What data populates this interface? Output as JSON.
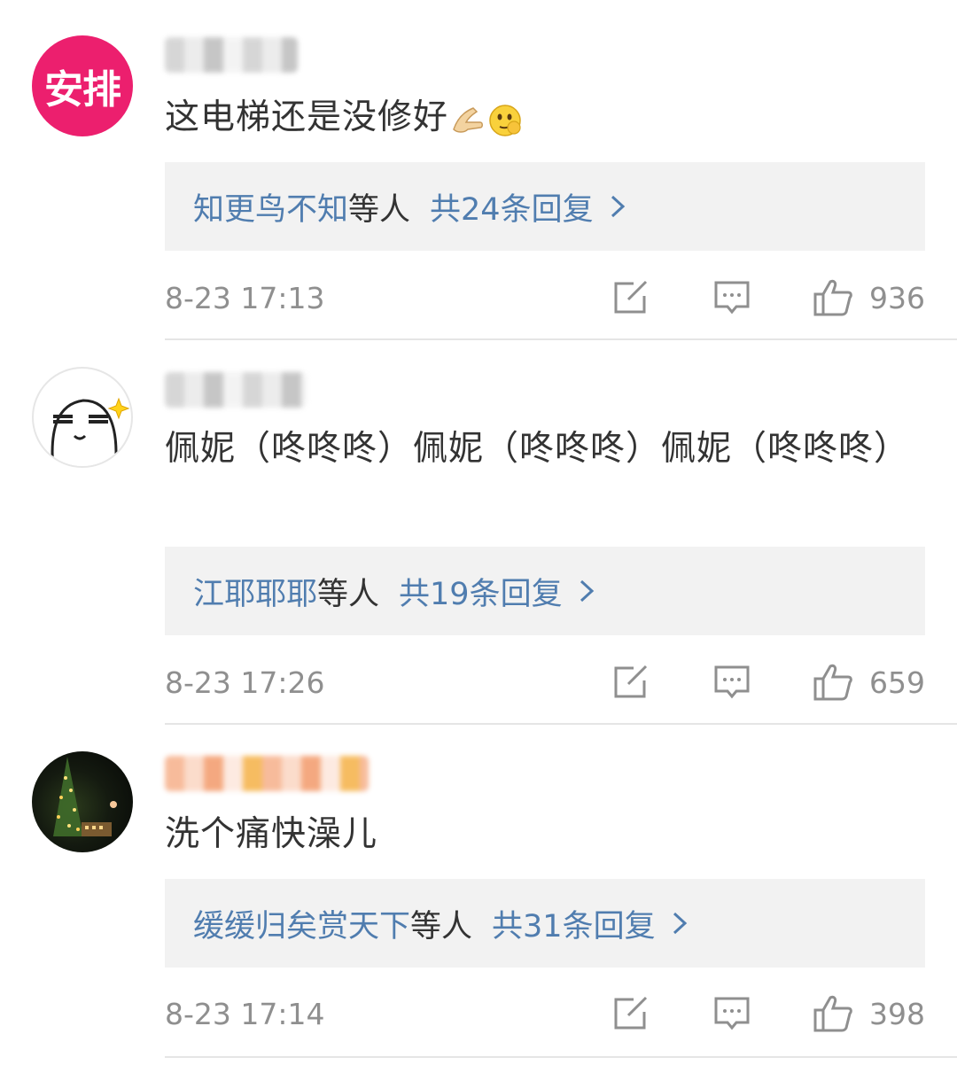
{
  "comments": [
    {
      "avatar_text": "安排",
      "text": "这电梯还是没修好",
      "emojis": [
        "pointing-hand-emoji",
        "smirk-face-emoji"
      ],
      "reply_names": "知更鸟不知",
      "reply_suffix": "等人",
      "reply_total": "共24条回复",
      "timestamp": "8-23 17:13",
      "likes": "936"
    },
    {
      "text": "佩妮（咚咚咚）佩妮（咚咚咚）佩妮（咚咚咚）",
      "reply_names": "江耶耶耶",
      "reply_suffix": "等人",
      "reply_total": "共19条回复",
      "timestamp": "8-23 17:26",
      "likes": "659"
    },
    {
      "text": "洗个痛快澡儿",
      "reply_names": "缓缓归矣赏天下",
      "reply_suffix": "等人",
      "reply_total": "共31条回复",
      "timestamp": "8-23 17:14",
      "likes": "398"
    }
  ],
  "colors": {
    "link": "#507daf",
    "reply_bg": "#f2f2f2",
    "meta_gray": "#8f8f8f",
    "avatar_pink": "#ec1f6e"
  },
  "icons": {
    "repost": "edit-square-icon",
    "comment": "comment-bubble-icon",
    "like": "thumbs-up-icon",
    "chevron": "chevron-right-icon"
  }
}
